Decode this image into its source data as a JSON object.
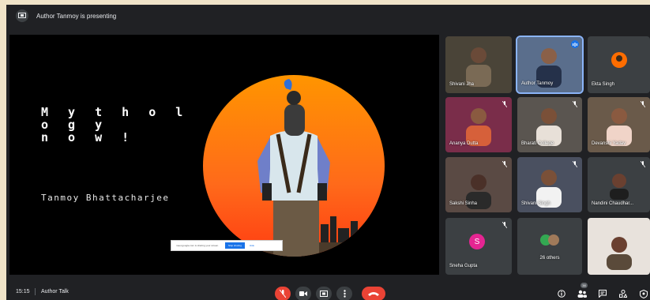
{
  "topbar": {
    "presenting_text": "Author Tanmoy is presenting"
  },
  "slide": {
    "title": "M y t h o l o g y\nn o w !",
    "author": "Tanmoy Bhattacharjee",
    "share_banner": {
      "message": "meet.google.com is sharing your screen.",
      "stop_label": "Stop sharing",
      "hide_label": "Hide"
    }
  },
  "participants": [
    {
      "name": "Shivani Jha"
    },
    {
      "name": "Author Tanmoy"
    },
    {
      "name": "Ekta Singh"
    },
    {
      "name": "Ananya Dutta"
    },
    {
      "name": "Bharati College"
    },
    {
      "name": "Devanshi Yadav"
    },
    {
      "name": "Sakshi Sinha"
    },
    {
      "name": "Shivani Singh"
    },
    {
      "name": "Nandini Chaudhar..."
    },
    {
      "name": "Sneha Gupta",
      "initial": "S"
    },
    {
      "name": "26 others"
    },
    {
      "name": ""
    }
  ],
  "bottombar": {
    "time": "15:15",
    "meeting_title": "Author Talk",
    "people_count": "38"
  },
  "colors": {
    "accent": "#8ab4f8",
    "end_call": "#ea4335",
    "background": "#202124"
  }
}
